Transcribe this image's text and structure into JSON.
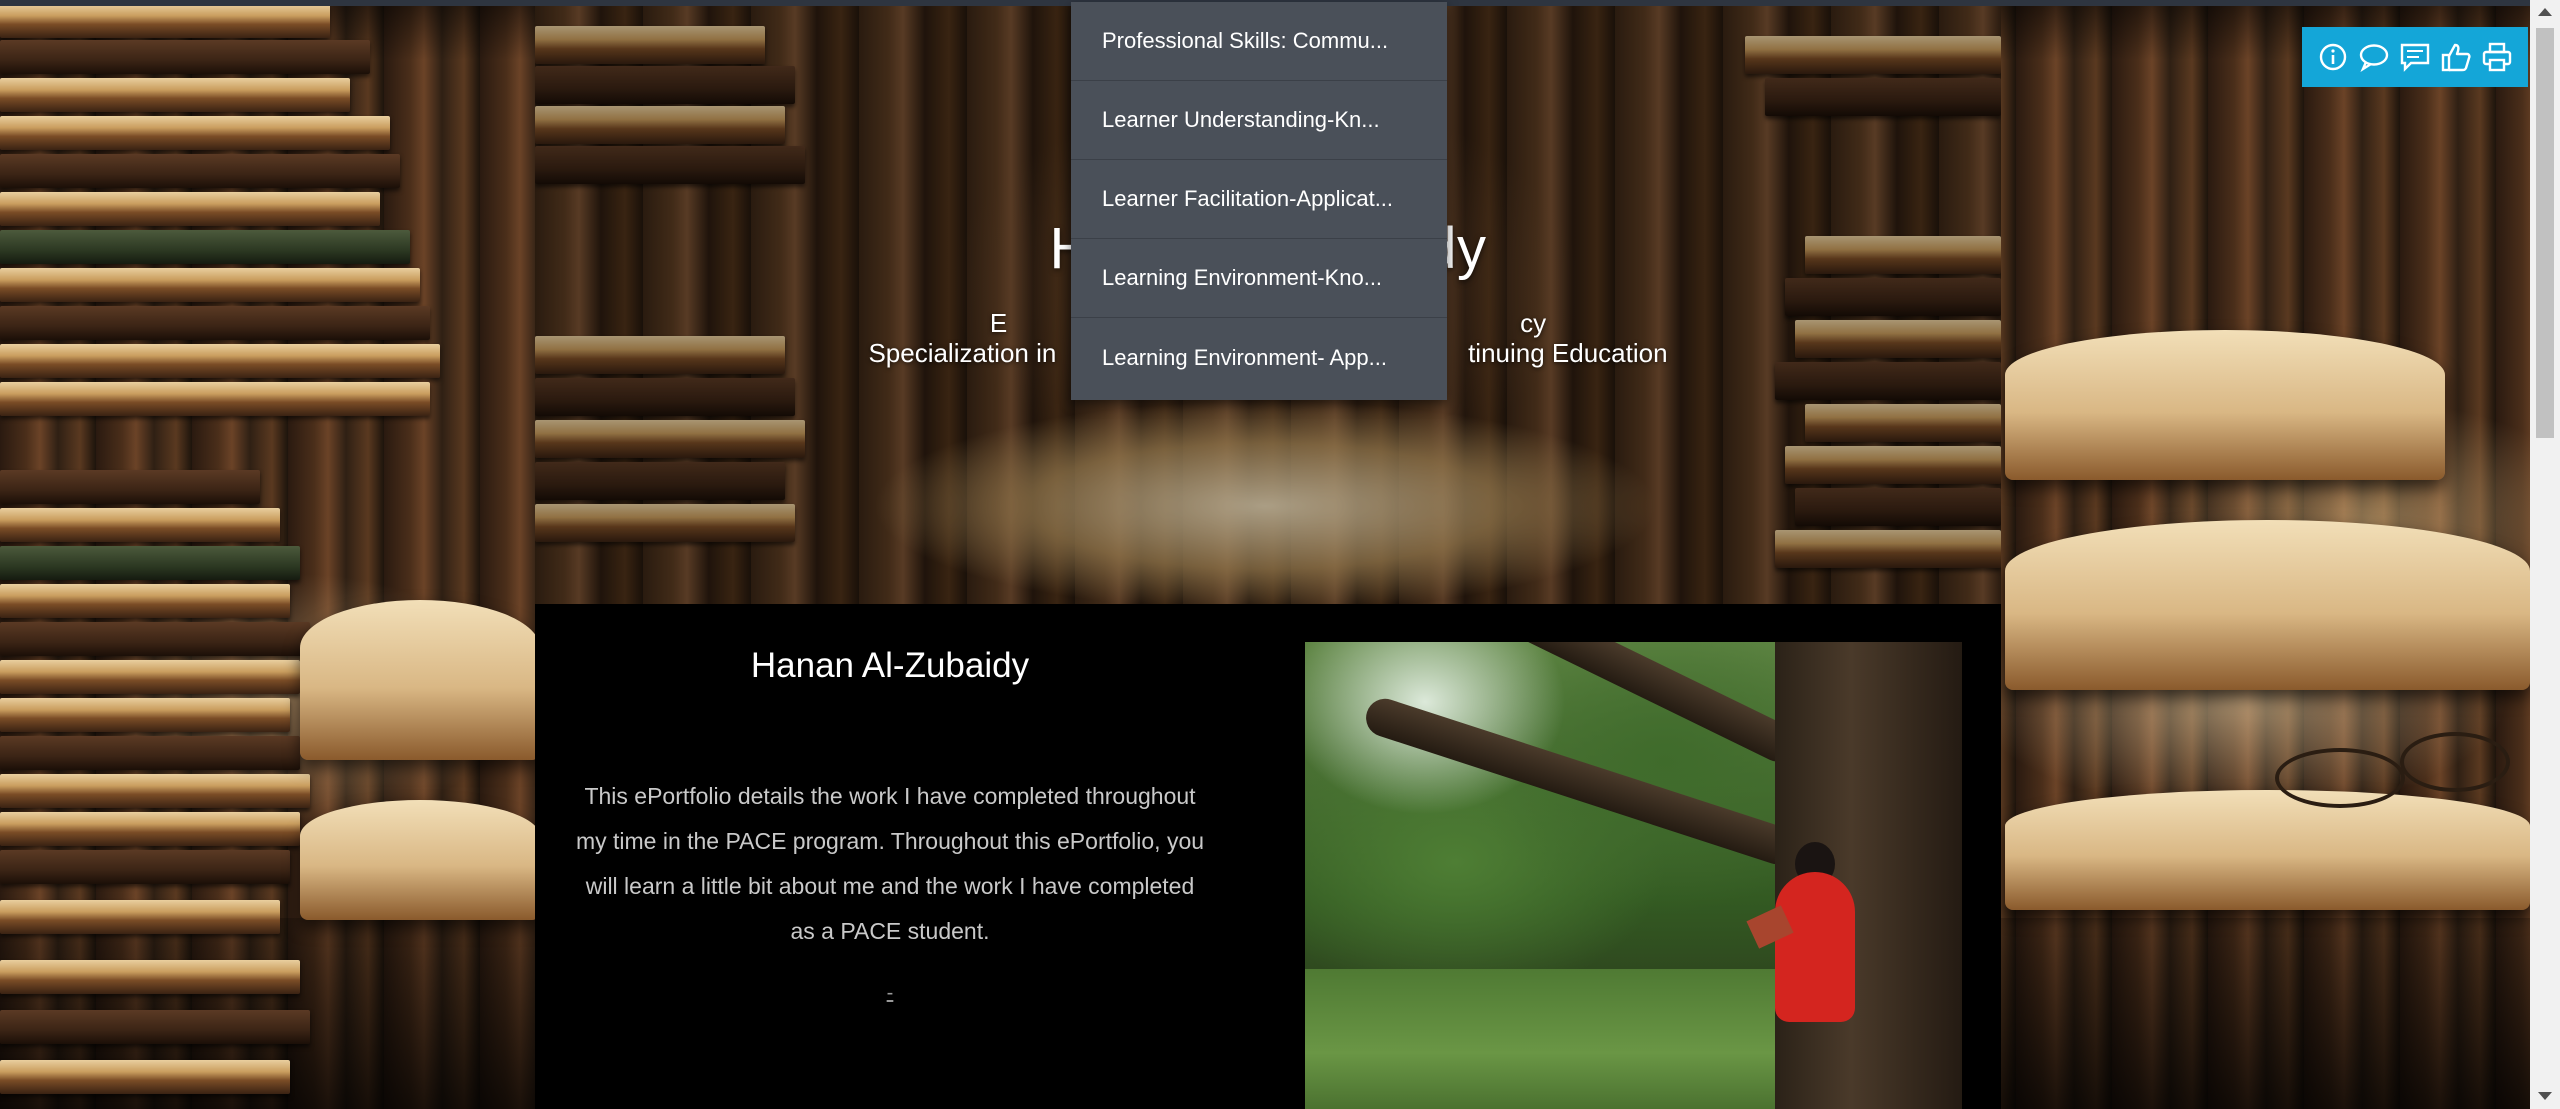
{
  "banner": {
    "title": "H                    dy",
    "subtitle_line1": "E                                                                       cy",
    "subtitle_line2": "Specialization in                                                         tinuing Education"
  },
  "intro": {
    "author_name": "Hanan Al-Zubaidy",
    "text": "This ePortfolio details the work I have completed throughout my time in the PACE program. Throughout this ePortfolio, you will learn a little bit about me and the work I have completed as a PACE student.",
    "marker": "-"
  },
  "dropdown": {
    "items": [
      {
        "label": "Professional Skills: Commu..."
      },
      {
        "label": "Learner Understanding-Kn..."
      },
      {
        "label": "Learner Facilitation-Applicat..."
      },
      {
        "label": "Learning Environment-Kno..."
      },
      {
        "label": "Learning Environment- App..."
      }
    ]
  },
  "toolbar": {
    "color": "#14a6d8",
    "buttons": [
      {
        "icon": "info-icon"
      },
      {
        "icon": "speech-bubble-icon"
      },
      {
        "icon": "comment-icon"
      },
      {
        "icon": "thumbs-up-icon"
      },
      {
        "icon": "print-icon"
      }
    ]
  },
  "colors": {
    "menu_background": "#4a5059",
    "content_background": "#000000",
    "intro_text": "#c9c9c9"
  }
}
